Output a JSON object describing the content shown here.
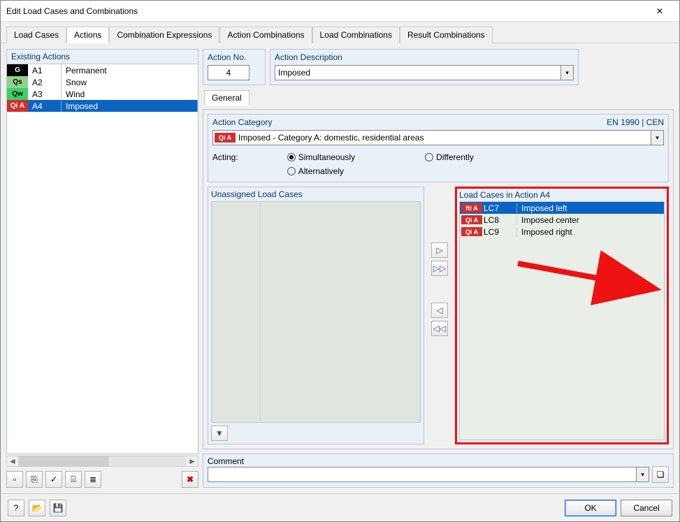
{
  "window_title": "Edit Load Cases and Combinations",
  "tabs": [
    "Load Cases",
    "Actions",
    "Combination Expressions",
    "Action Combinations",
    "Load Combinations",
    "Result Combinations"
  ],
  "active_tab": 1,
  "existing_actions_title": "Existing Actions",
  "existing_actions": [
    {
      "tag": "G",
      "tagClass": "G",
      "id": "A1",
      "name": "Permanent"
    },
    {
      "tag": "Qs",
      "tagClass": "Qs",
      "id": "A2",
      "name": "Snow"
    },
    {
      "tag": "Qw",
      "tagClass": "Qw",
      "id": "A3",
      "name": "Wind"
    },
    {
      "tag": "Qi A",
      "tagClass": "QiA",
      "id": "A4",
      "name": "Imposed"
    }
  ],
  "selected_action_index": 3,
  "action_no_label": "Action No.",
  "action_no": "4",
  "action_desc_label": "Action Description",
  "action_desc": "Imposed",
  "subtab_general": "General",
  "category_label": "Action Category",
  "category_standard": "EN 1990 | CEN",
  "category_tag": "Qi A",
  "category_text": "Imposed - Category A: domestic, residential areas",
  "acting_label": "Acting:",
  "radio_simul": "Simultaneously",
  "radio_diff": "Differently",
  "radio_alt": "Alternatively",
  "unassigned_title": "Unassigned Load Cases",
  "assigned_title": "Load Cases in Action A4",
  "assigned": [
    {
      "tag": "fti A",
      "tagClass": "QiA",
      "lc": "LC7",
      "name": "Imposed left"
    },
    {
      "tag": "Qi A",
      "tagClass": "QiA",
      "lc": "LC8",
      "name": "Imposed center"
    },
    {
      "tag": "Qi A",
      "tagClass": "QiA",
      "lc": "LC9",
      "name": "Imposed right"
    }
  ],
  "comment_label": "Comment",
  "ok_label": "OK",
  "cancel_label": "Cancel",
  "icons": {
    "close": "✕",
    "dd": "▾",
    "right": "▷",
    "right2": "▷▷",
    "left": "◁",
    "left2": "◁◁",
    "filter": "▼",
    "new": "▫",
    "copy": "⎘",
    "check": "✓",
    "tree": "⌸",
    "cols": "≣",
    "del": "✖",
    "help": "?",
    "open": "📂",
    "save": "💾",
    "stack": "❏"
  }
}
